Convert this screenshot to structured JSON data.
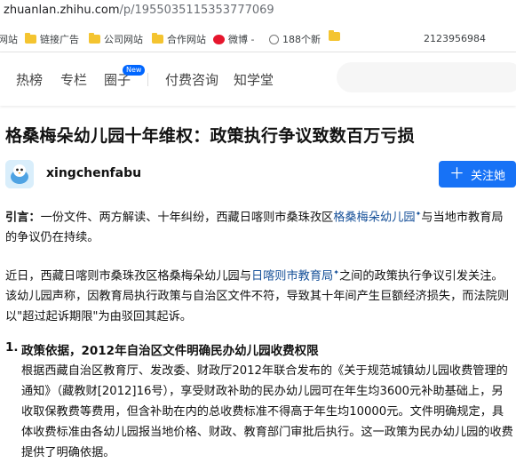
{
  "browser": {
    "url_host": "zhuanlan.zhihu.com",
    "url_path": "/p/1955035115353777069"
  },
  "bookmarks": {
    "items": [
      {
        "label": "网站",
        "icon": "globe-icon"
      },
      {
        "label": "链接广告",
        "icon": "folder-icon"
      },
      {
        "label": "公司网站",
        "icon": "folder-icon"
      },
      {
        "label": "合作网站",
        "icon": "folder-icon"
      },
      {
        "label": "微博 -",
        "icon": "weibo-icon"
      },
      {
        "label": "188个新",
        "icon": "globe-icon"
      },
      {
        "label": "",
        "icon": "folder-icon"
      }
    ],
    "number": "2123956984"
  },
  "nav": {
    "items": [
      "热榜",
      "专栏",
      "圈子",
      "付费咨询",
      "知学堂"
    ],
    "new_badge": "New"
  },
  "article": {
    "title": "格桑梅朵幼儿园十年维权：政策执行争议致数百万亏损",
    "author": "xingchenfabu",
    "follow_label": "关注她",
    "intro_label": "引言：",
    "intro_text_1": "一份文件、两方解读、十年纠纷，西藏日喀则市桑珠孜区",
    "intro_link": "格桑梅朵幼儿园",
    "intro_text_2": "与当地市教育局的争议仍在持续。",
    "p2_text_1": "近日，西藏日喀则市桑珠孜区格桑梅朵幼儿园与",
    "p2_link": "日喀则市教育局",
    "p2_text_2": "之间的政策执行争议引发关注。该幼儿园声称，因教育局执行政策与自治区文件不符，导致其十年间产生巨额经济损失，而法院则以\"超过起诉期限\"为由驳回其起诉。",
    "list_number": "1.",
    "list_heading": "政策依据，2012年自治区文件明确民办幼儿园收费权限",
    "list_body": "根据西藏自治区教育厅、发改委、财政厅2012年联合发布的《关于规范城镇幼儿园收费管理的通知》（藏教财[2012]16号），享受财政补助的民办幼儿园可在年生均3600元补助基础上，另收取保教费等费用，但含补助在内的总收费标准不得高于年生均10000元。文件明确规定，具体收费标准由各幼儿园报当地价格、财政、教育部门审批后执行。这一政策为民办幼儿园的收费提供了明确依据。"
  },
  "colors": {
    "brand_blue": "#1772f6",
    "link_blue": "#175199",
    "badge_blue": "#0066ff"
  }
}
